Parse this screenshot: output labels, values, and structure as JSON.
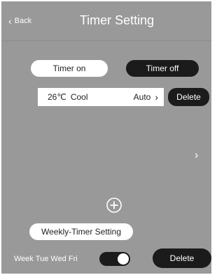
{
  "header": {
    "back_label": "Back",
    "title": "Timer Setting"
  },
  "tabs": {
    "timer_on_label": "Timer on",
    "timer_off_label": "Timer off"
  },
  "timer_entry": {
    "temperature": "26℃",
    "mode": "Cool",
    "fan": "Auto"
  },
  "buttons": {
    "delete_top_label": "Delete",
    "weekly_timer_label": "Weekly-Timer Setting",
    "delete_bottom_label": "Delete"
  },
  "weekly": {
    "days_label": "Week Tue Wed Fri",
    "toggle_on": true
  },
  "icons": {
    "back": "chevron-left-icon",
    "entry_chevron": "chevron-right-icon",
    "side_chevron": "chevron-right-icon",
    "add": "plus-circle-icon"
  },
  "colors": {
    "background": "#999999",
    "dark_button": "#1b1b1b",
    "light_button": "#ffffff",
    "text_light": "#ffffff"
  }
}
